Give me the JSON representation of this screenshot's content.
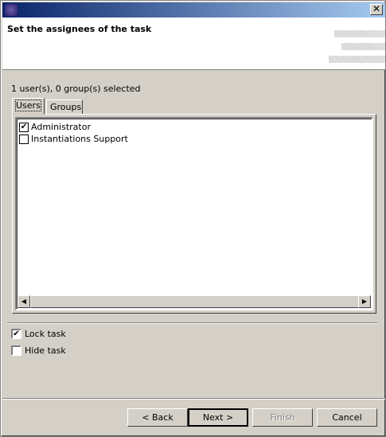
{
  "window": {
    "title": "",
    "close_label": "✕"
  },
  "header": {
    "title": "Set the assignees of the task"
  },
  "status": "1 user(s), 0 group(s) selected",
  "tabs": [
    {
      "label": "Users",
      "active": true
    },
    {
      "label": "Groups",
      "active": false
    }
  ],
  "users": [
    {
      "name": "Administrator",
      "checked": true
    },
    {
      "name": "Instantiations Support",
      "checked": false
    }
  ],
  "options": [
    {
      "label": "Lock task",
      "checked": true
    },
    {
      "label": "Hide task",
      "checked": false
    }
  ],
  "buttons": {
    "back": "< Back",
    "next": "Next >",
    "finish": "Finish",
    "cancel": "Cancel"
  },
  "check_glyph": "✔",
  "scroll": {
    "left": "◀",
    "right": "▶"
  }
}
